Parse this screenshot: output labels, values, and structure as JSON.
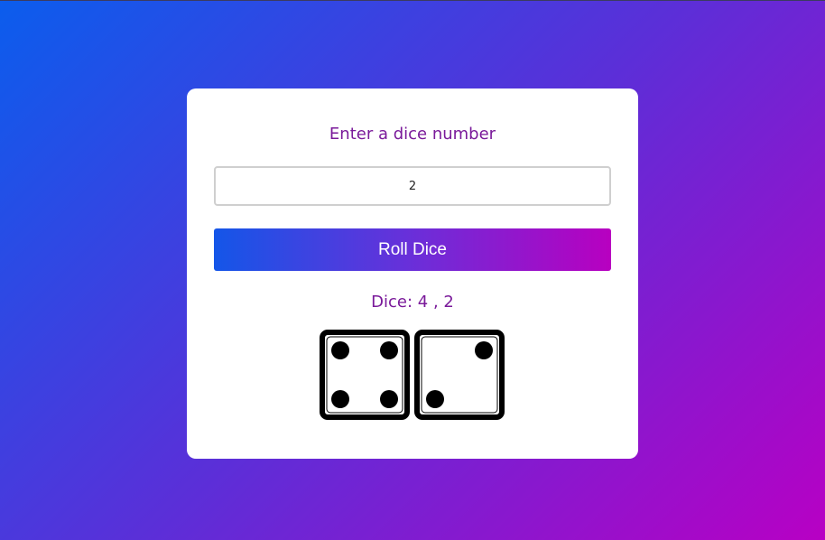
{
  "form": {
    "prompt": "Enter a dice number",
    "input_value": "2",
    "roll_button_label": "Roll Dice"
  },
  "result": {
    "text": "Dice: 4 , 2",
    "dice_faces": [
      4,
      2
    ]
  },
  "colors": {
    "accent_text": "#7a1a9a",
    "gradient_start": "#0b5ded",
    "gradient_end": "#b800c4"
  }
}
